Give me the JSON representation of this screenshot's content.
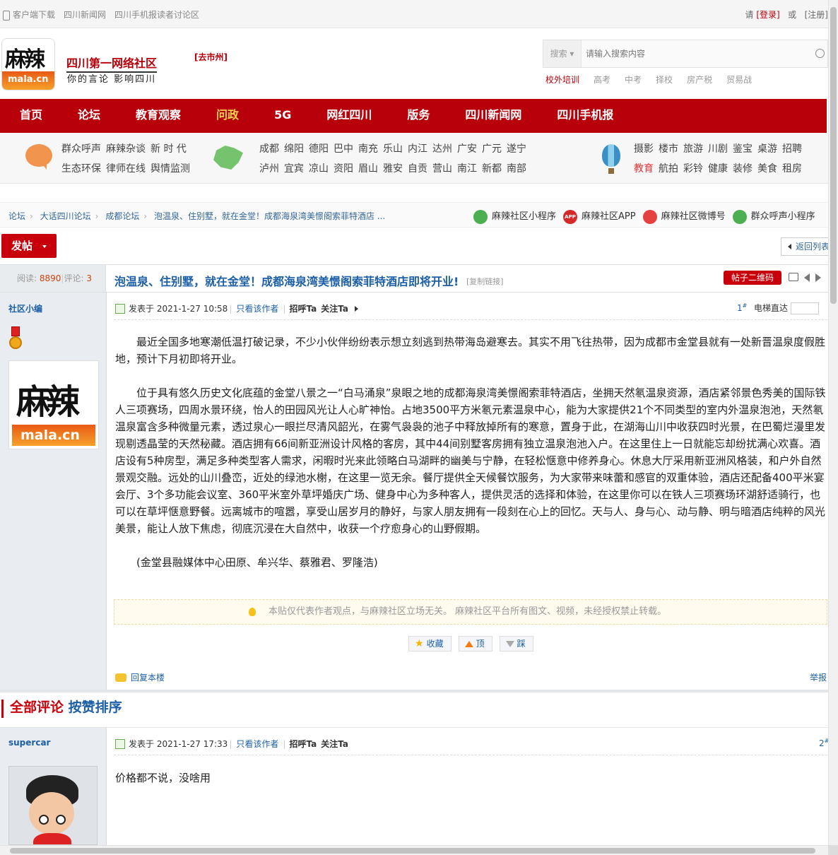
{
  "topbar": {
    "client": "客户端下载",
    "news": "四川新闻网",
    "readers": "四川手机报读者讨论区",
    "please": "请",
    "login": "[登录]",
    "or": "或",
    "register": "[注册]"
  },
  "header": {
    "logo_text": "麻辣",
    "logo_domain": "mala.cn",
    "slogan_main": "四川第一网络社区",
    "slogan_sub": "你的言论 影响四川",
    "city_link": "[去市州]"
  },
  "search": {
    "type_label": "搜索",
    "placeholder": "请输入搜索内容",
    "hot": [
      "校外培训",
      "高考",
      "中考",
      "择校",
      "房产税",
      "贸易战"
    ]
  },
  "nav": [
    "首页",
    "论坛",
    "教育观察",
    "问政",
    "5G",
    "网红四川",
    "版务",
    "四川新闻网",
    "四川手机报"
  ],
  "nav_active_index": 3,
  "categories": {
    "col1_row1": [
      "群众呼声",
      "麻辣杂谈",
      "新 时 代"
    ],
    "col1_row2": [
      "生态环保",
      "律师在线",
      "舆情监测"
    ],
    "col2_row1": [
      "成都",
      "绵阳",
      "德阳",
      "巴中",
      "南充",
      "乐山",
      "内江",
      "达州",
      "广安",
      "广元",
      "遂宁"
    ],
    "col2_row2": [
      "泸州",
      "宜宾",
      "凉山",
      "资阳",
      "眉山",
      "雅安",
      "自贡",
      "营山",
      "南江",
      "新都",
      "南部"
    ],
    "col3_row1": [
      "摄影",
      "楼市",
      "旅游",
      "川剧",
      "鉴宝",
      "桌游",
      "招聘"
    ],
    "col3_row2": [
      "教育",
      "航拍",
      "彩铃",
      "健康",
      "装修",
      "美食",
      "租房"
    ]
  },
  "breadcrumb": [
    "论坛",
    "大话四川论坛",
    "成都论坛",
    "泡温泉、住别墅，就在金堂！成都海泉湾美憬阁索菲特酒店 ..."
  ],
  "apps": [
    "麻辣社区小程序",
    "麻辣社区APP",
    "麻辣社区微博号",
    "群众呼声小程序"
  ],
  "app_badge": "APP",
  "toolbar": {
    "post_label": "发帖",
    "back_label": "返回列表"
  },
  "thread": {
    "views_label": "阅读:",
    "views": "8890",
    "replies_label": "评论:",
    "replies": "3",
    "title": "泡温泉、住别墅，就在金堂！成都海泉湾美憬阁索菲特酒店即将开业!",
    "copy_link": "[复制链接]",
    "qr_label": "帖子二维码"
  },
  "post1": {
    "author": "社区小编",
    "posted": "发表于 2021-1-27 10:58",
    "only_author": "只看该作者",
    "greet": "招呼Ta",
    "follow": "关注Ta",
    "floor": "1",
    "floor_mark": "#",
    "jump_label": "电梯直达",
    "paragraphs": [
      "最近全国多地寒潮低温打破记录，不少小伙伴纷纷表示想立刻逃到热带海岛避寒去。其实不用飞往热带，因为成都市金堂县就有一处新晋温泉度假胜地，预计下月初即将开业。",
      "位于具有悠久历史文化底蕴的金堂八景之一“白马涌泉”泉眼之地的成都海泉湾美憬阁索菲特酒店，坐拥天然氡温泉资源，酒店紧邻景色秀美的国际铁人三项赛场，四周水景环绕，怡人的田园风光让人心旷神怡。占地3500平方米氡元素温泉中心，能为大家提供21个不同类型的室内外温泉泡池，天然氡温泉富含多种微量元素，透过泉心一眼拦尽清风韶光，在雾气袅袅的池子中释放掉所有的寒意，置身于此，在湖海山川中收获四时光景，在巴蜀烂漫里发现剔透晶莹的天然秘藏。酒店拥有66间新亚洲设计风格的客房，其中44间别墅客房拥有独立温泉泡池入户。在这里住上一日就能忘却纷扰满心欢喜。酒店设有5种房型，满足多种类型客人需求，闲暇时光来此领略白马湖畔的幽美与宁静，在轻松惬意中修养身心。休息大厅采用新亚洲风格装，和户外自然景观交融。远处的山川叠峦，近处的绿池水榭，在这里一览无余。餐厅提供全天候餐饮服务，为大家带来味蕾和感官的双重体验，酒店还配备400平米宴会厅、3个多功能会议室、360平米室外草坪婚庆广场、健身中心为多种客人，提供灵活的选择和体验，在这里你可以在铁人三项赛场环湖舒适骑行，也可以在草坪惬意野餐。远离城市的喧嚣，享受山居岁月的静好，与家人朋友拥有一段刻在心上的回忆。天与人、身与心、动与静、明与暗酒店纯粹的风光美景，能让人放下焦虑，彻底沉浸在大自然中，收获一个疗愈身心的山野假期。",
      "(金堂县融媒体中心田原、牟兴华、蔡雅君、罗隆浩)"
    ],
    "notice": "本贴仅代表作者观点，与麻辣社区立场无关。 麻辣社区平台所有图文、视频，未经授权禁止转载。",
    "collect": "收藏",
    "up": "顶",
    "down": "踩",
    "reply": "回复本楼",
    "report": "举报"
  },
  "comments": {
    "all": "全部评论",
    "sort": "按赞排序"
  },
  "post2": {
    "author": "supercar",
    "posted": "发表于 2021-1-27 17:33",
    "only_author": "只看该作者",
    "greet": "招呼Ta",
    "follow": "关注Ta",
    "floor": "2",
    "floor_mark": "#",
    "content": "价格都不说，没啥用"
  }
}
